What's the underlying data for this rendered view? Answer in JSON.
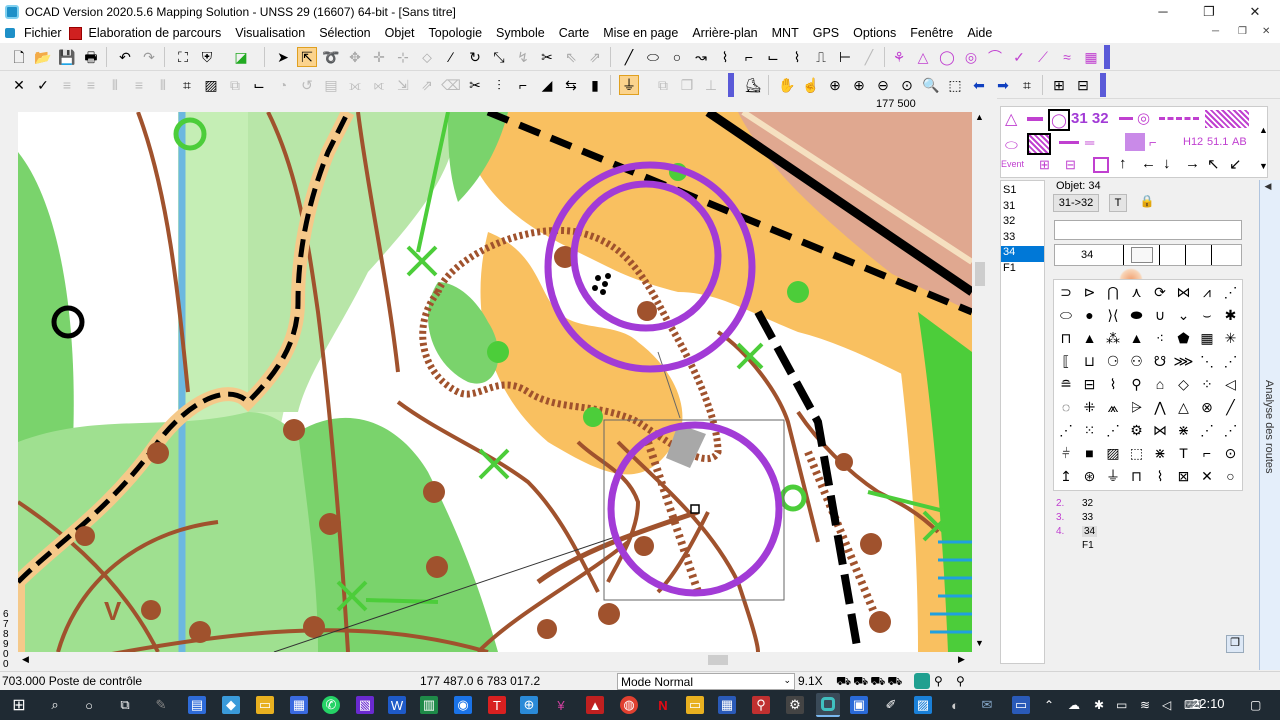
{
  "window": {
    "title": "OCAD Version 2020.5.6 Mapping Solution - UNSS 29 (16607) 64-bit - [Sans titre]",
    "minimize": "─",
    "restore": "❐",
    "close": "✕"
  },
  "menu": [
    "Fichier",
    "Elaboration de parcours",
    "Visualisation",
    "Sélection",
    "Objet",
    "Topologie",
    "Symbole",
    "Carte",
    "Mise en page",
    "Arrière-plan",
    "MNT",
    "GPS",
    "Options",
    "Fenêtre",
    "Aide"
  ],
  "mdi_buttons": [
    "─",
    "❐",
    "✕"
  ],
  "map": {
    "ruler_top_label": "177 500",
    "ruler_left_label": "6 7 8 9 0 0"
  },
  "symbols_panel": {
    "course_codes": "31 32",
    "labels": [
      "H12",
      "51.1",
      "AB",
      "Event"
    ]
  },
  "course_list": [
    "S1",
    "31",
    "32",
    "33",
    "34",
    "F1"
  ],
  "object_panel": {
    "object_label": "Objet: 34",
    "leg_label": "31->32",
    "t_button": "T",
    "code_value": "34",
    "sequence": [
      {
        "num": "2.",
        "code": "32"
      },
      {
        "num": "3.",
        "code": "33"
      },
      {
        "num": "4.",
        "code": "34"
      },
      {
        "num": "",
        "code": "F1"
      }
    ]
  },
  "side_tab": "Analyse des routes",
  "status": {
    "message": "703.000 Poste de contrôle",
    "coords": "177 487.0   6 783 017.2",
    "mode": "Mode Normal",
    "zoom": "9.1X"
  },
  "taskbar": {
    "time": "22:10"
  },
  "colors": {
    "ocad_blue": "#5a5ad8",
    "course_purple": "#a23bd6",
    "selection_blue": "#0078d7",
    "map_brown": "#a0522d",
    "map_green": "#7ad36c",
    "map_orange": "#f9c060"
  }
}
